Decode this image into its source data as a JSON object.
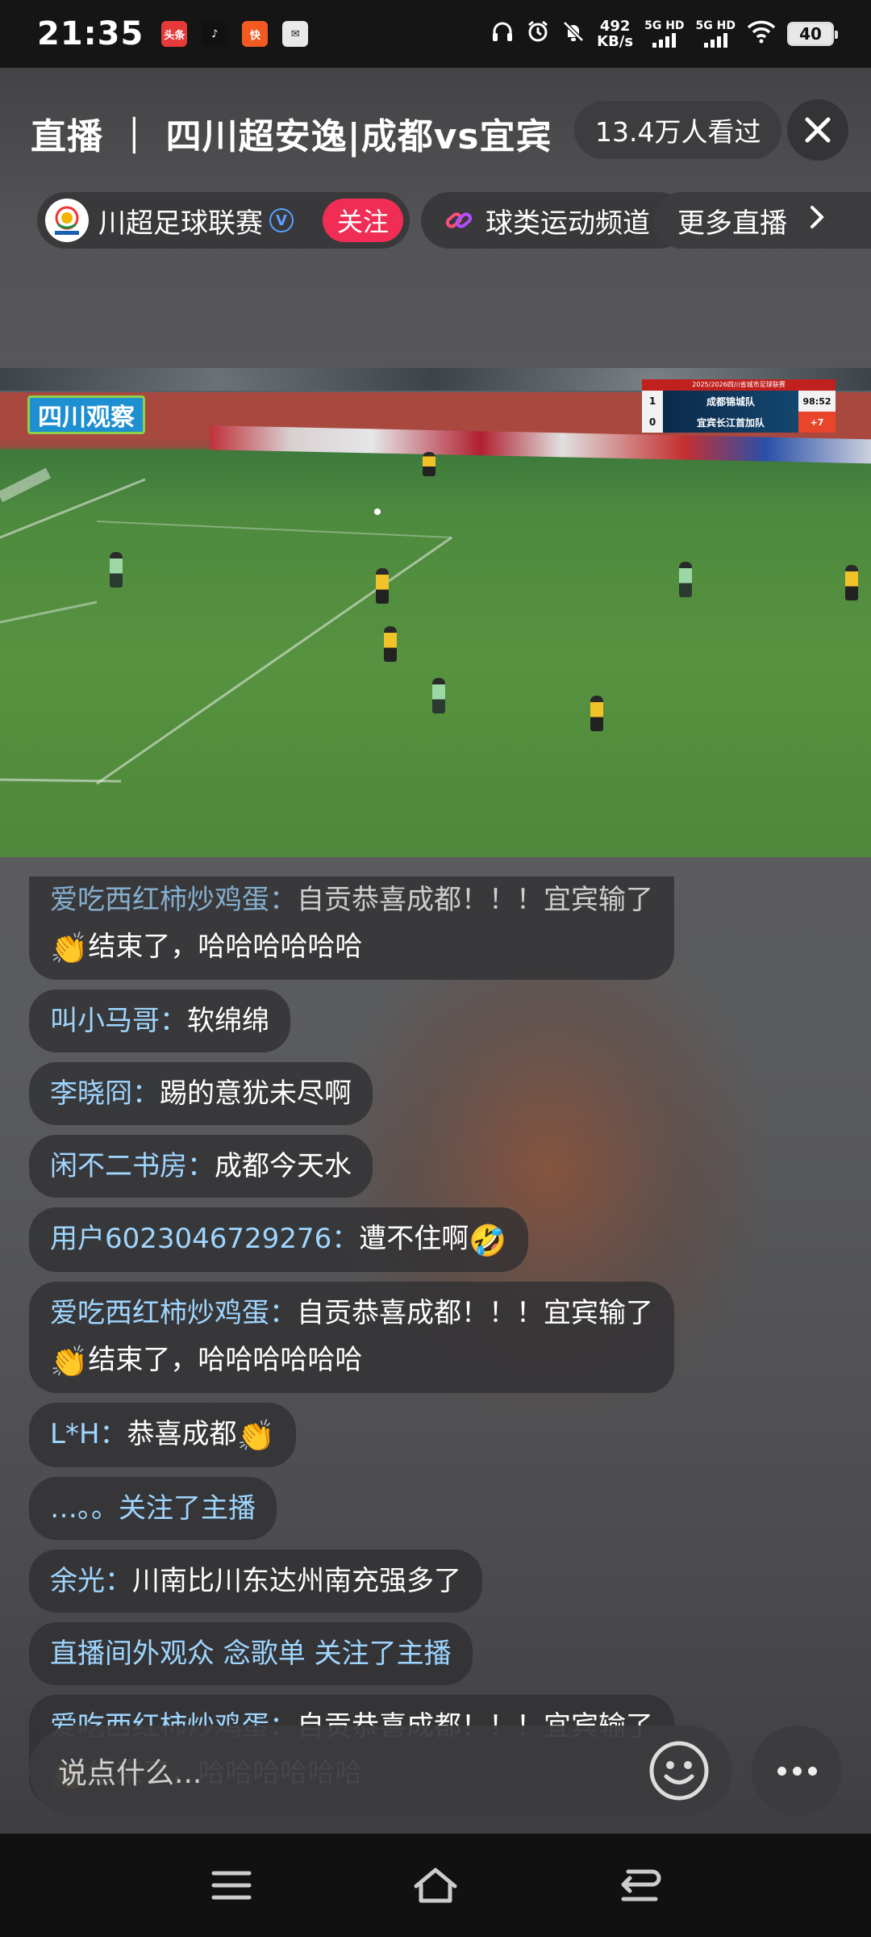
{
  "status_bar": {
    "time": "21:35",
    "apps": [
      {
        "name": "toutiao-app-icon",
        "label": "头条",
        "color": "#e63a3a"
      },
      {
        "name": "tiktok-app-icon",
        "label": "♪",
        "color": "#111111"
      },
      {
        "name": "kuaishou-app-icon",
        "label": "快",
        "color": "#f25a22"
      },
      {
        "name": "message-app-icon",
        "label": "✉",
        "color": "#e9e9e9"
      }
    ],
    "net_speed_value": "492",
    "net_speed_unit": "KB/s",
    "sim1_label": "5G HD",
    "sim2_label": "5G HD",
    "battery": "40"
  },
  "header": {
    "title": "直播 ｜ 四川超安逸|成都vs宜宾",
    "viewers": "13.4万人看过"
  },
  "channel": {
    "name": "川超足球联赛",
    "follow_label": "关注",
    "category": "球类运动频道",
    "more_label": "更多直播"
  },
  "video": {
    "broadcaster": "四川观察",
    "scoreboard": {
      "competition": "2025/2026四川省城市足球联赛",
      "home_team": "成都锦城队",
      "home_score": "1",
      "away_team": "宜宾长江首加队",
      "away_score": "0",
      "clock": "98:52",
      "added_time": "+7"
    }
  },
  "chat": {
    "messages": [
      {
        "user": "爱吃西红柿炒鸡蛋：",
        "text": "自贡恭喜成都！！！宜宾输了",
        "line2_emoji": "👏",
        "line2": "结束了，哈哈哈哈哈哈",
        "partial": true
      },
      {
        "user": "叫小马哥：",
        "text": "软绵绵"
      },
      {
        "user": "李晓冏：",
        "text": "踢的意犹未尽啊"
      },
      {
        "user": "闲不二书房：",
        "text": "成都今天水"
      },
      {
        "user": "用户6023046729276：",
        "text": "遭不住啊",
        "trailing_emoji": "🤣"
      },
      {
        "user": "爱吃西红柿炒鸡蛋：",
        "text": "自贡恭喜成都！！！宜宾输了",
        "line2_emoji": "👏",
        "line2": "结束了，哈哈哈哈哈哈"
      },
      {
        "user": "L*H：",
        "text": "恭喜成都",
        "trailing_emoji": "👏"
      },
      {
        "system": "…。。关注了主播"
      },
      {
        "user": "余光：",
        "text": "川南比川东达州南充强多了"
      },
      {
        "system": "直播间外观众 念歌单 关注了主播"
      },
      {
        "user": "爱吃西红柿炒鸡蛋：",
        "text": "自贡恭喜成都！！！宜宾输了",
        "line2_emoji": "👏",
        "line2": "结束了，哈哈哈哈哈哈"
      }
    ]
  },
  "input": {
    "placeholder": "说点什么..."
  }
}
